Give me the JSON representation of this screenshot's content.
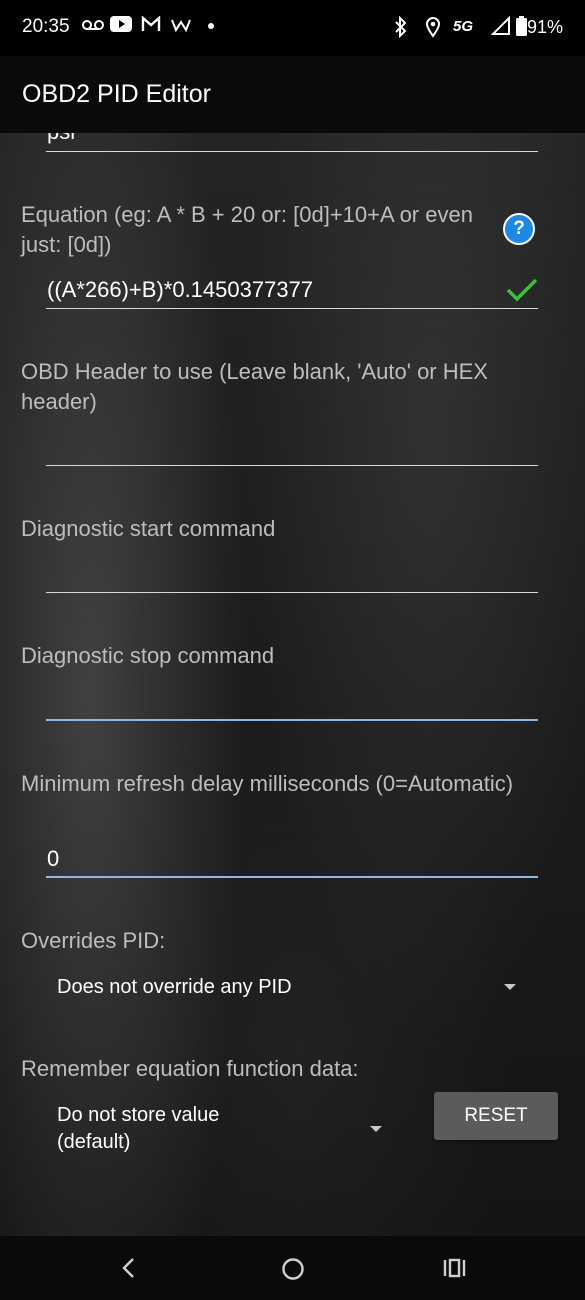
{
  "status_bar": {
    "time": "20:35",
    "notification_icons": [
      "voicemail-icon",
      "youtube-icon",
      "gmail-icon",
      "w-app-icon",
      "dot-icon"
    ],
    "system_icons": [
      "bluetooth-icon",
      "location-icon",
      "5g-icon",
      "signal-icon",
      "battery-icon"
    ],
    "network": "5G",
    "battery": "91%"
  },
  "app_bar": {
    "title": "OBD2 PID Editor"
  },
  "form": {
    "units_value": "psi",
    "equation": {
      "label": "Equation (eg:  A * B + 20   or: [0d]+10+A  or even just: [0d])",
      "value": "((A*266)+B)*0.1450377377",
      "help_icon": "?",
      "valid_icon": "check-icon",
      "valid_color": "#3dbd3d"
    },
    "obd_header": {
      "label": "OBD Header to use (Leave blank, 'Auto' or HEX header)",
      "value": ""
    },
    "diag_start": {
      "label": "Diagnostic start command",
      "value": ""
    },
    "diag_stop": {
      "label": "Diagnostic stop command",
      "value": ""
    },
    "min_refresh": {
      "label": "Minimum refresh delay milliseconds (0=Automatic)",
      "value": "0"
    },
    "overrides_pid": {
      "label": "Overrides PID:",
      "selected": "Does not override any PID"
    },
    "remember": {
      "label": "Remember equation function data:",
      "selected_line1": "Do not store value",
      "selected_line2": "(default)",
      "reset_label": "RESET"
    },
    "focus_color": "#8fb8e6"
  },
  "nav_bar": {
    "buttons": [
      "back-icon",
      "home-icon",
      "recents-icon"
    ]
  }
}
